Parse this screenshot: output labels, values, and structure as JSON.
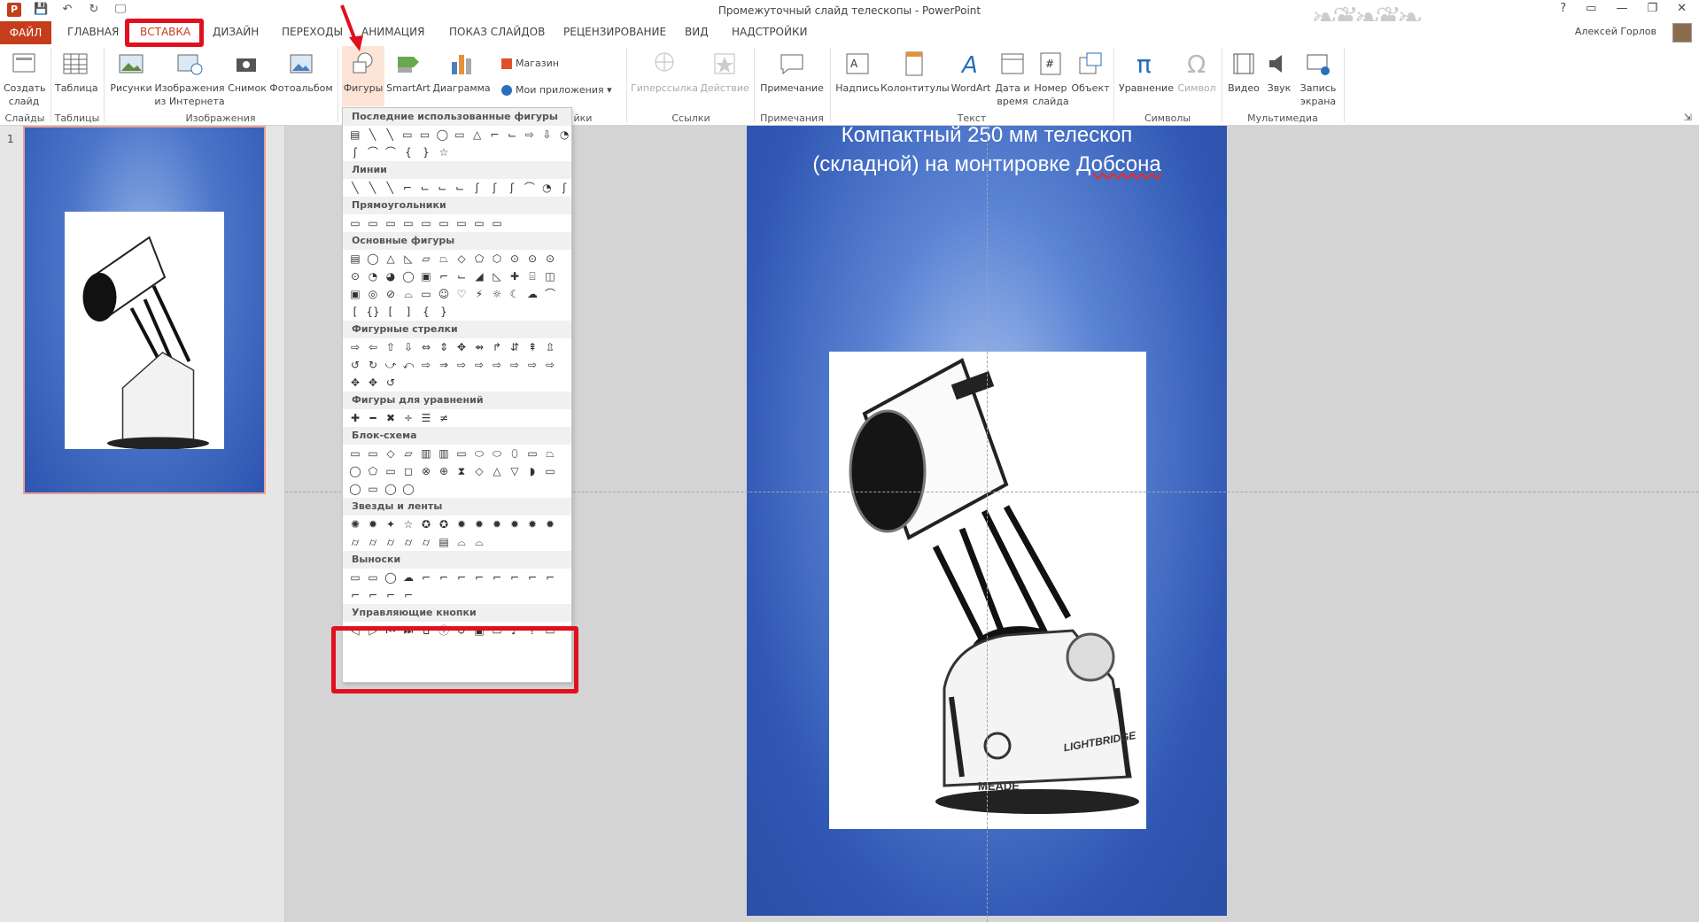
{
  "window": {
    "title": "Промежуточный слайд телескопы - PowerPoint",
    "controls": [
      "?",
      "▭",
      "—",
      "❐",
      "✕"
    ]
  },
  "qat": [
    "P",
    "💾",
    "↶",
    "↻",
    "🖵"
  ],
  "user": {
    "name": "Алексей Горлов"
  },
  "tabs": [
    {
      "label": "ФАЙЛ"
    },
    {
      "label": "ГЛАВНАЯ"
    },
    {
      "label": "ВСТАВКА"
    },
    {
      "label": "ДИЗАЙН"
    },
    {
      "label": "ПЕРЕХОДЫ"
    },
    {
      "label": "АНИМАЦИЯ"
    },
    {
      "label": "ПОКАЗ СЛАЙДОВ"
    },
    {
      "label": "РЕЦЕНЗИРОВАНИЕ"
    },
    {
      "label": "ВИД"
    },
    {
      "label": "НАДСТРОЙКИ"
    }
  ],
  "ribbon": {
    "new_slide": "Создать слайд",
    "table": "Таблица",
    "pictures": "Рисунки",
    "online_pictures": "Изображения из Интернета",
    "screenshot": "Снимок",
    "photo_album": "Фотоальбом",
    "shapes": "Фигуры",
    "smartart": "SmartArt",
    "chart": "Диаграмма",
    "store": "Магазин",
    "my_apps": "Мои приложения",
    "hyperlink": "Гиперссылка",
    "action": "Действие",
    "comment": "Примечание",
    "textbox": "Надпись",
    "header_footer": "Колонтитулы",
    "wordart": "WordArt",
    "date_time": "Дата и время",
    "slide_number": "Номер слайда",
    "object": "Объект",
    "equation": "Уравнение",
    "symbol": "Символ",
    "video": "Видео",
    "audio": "Звук",
    "screen_recording": "Запись экрана",
    "groups": {
      "slides": "Слайды",
      "tables": "Таблицы",
      "images": "Изображения",
      "addins_partial": "йки",
      "links": "Ссылки",
      "comments": "Примечания",
      "text": "Текст",
      "symbols": "Символы",
      "media": "Мультимедиа"
    }
  },
  "thumbnail": {
    "number": "1"
  },
  "shapes_menu": {
    "sections": [
      {
        "title": "Последние использованные фигуры",
        "rows": [
          [
            "▤",
            "╲",
            "╲",
            "▭",
            "▭",
            "◯",
            "▭",
            "△",
            "⌐",
            "⌙",
            "⇨",
            "⇩",
            "◔"
          ],
          [
            "ʃ",
            "⌒",
            "⌒",
            "{",
            "}",
            "☆"
          ]
        ]
      },
      {
        "title": "Линии",
        "rows": [
          [
            "╲",
            "╲",
            "╲",
            "⌐",
            "⌙",
            "⌙",
            "⌙",
            "ʃ",
            "ʃ",
            "ʃ",
            "⌒",
            "◔",
            "ʃ"
          ]
        ]
      },
      {
        "title": "Прямоугольники",
        "rows": [
          [
            "▭",
            "▭",
            "▭",
            "▭",
            "▭",
            "▭",
            "▭",
            "▭",
            "▭"
          ]
        ]
      },
      {
        "title": "Основные фигуры",
        "rows": [
          [
            "▤",
            "◯",
            "△",
            "◺",
            "▱",
            "⏢",
            "◇",
            "⬠",
            "⬡",
            "⊙",
            "⊙",
            "⊙"
          ],
          [
            "⊙",
            "◔",
            "◕",
            "◯",
            "▣",
            "⌐",
            "⌙",
            "◢",
            "◺",
            "✚",
            "⌸",
            "◫"
          ],
          [
            "▣",
            "◎",
            "⊘",
            "⌓",
            "▭",
            "☺",
            "♡",
            "⚡",
            "☼",
            "☾",
            "☁",
            "⌒"
          ],
          [
            "[",
            "{}",
            "[",
            "]",
            "{",
            "}"
          ]
        ]
      },
      {
        "title": "Фигурные стрелки",
        "rows": [
          [
            "⇨",
            "⇦",
            "⇧",
            "⇩",
            "⇔",
            "⇕",
            "✥",
            "⇴",
            "↱",
            "⇵",
            "⇞",
            "⇫"
          ],
          [
            "↺",
            "↻",
            "⤻",
            "⤺",
            "⇨",
            "⇒",
            "⇨",
            "⇨",
            "⇨",
            "⇨",
            "⇨",
            "⇨"
          ],
          [
            "✥",
            "✥",
            "↺"
          ]
        ]
      },
      {
        "title": "Фигуры для уравнений",
        "rows": [
          [
            "✚",
            "━",
            "✖",
            "÷",
            "☰",
            "≠"
          ]
        ]
      },
      {
        "title": "Блок-схема",
        "rows": [
          [
            "▭",
            "▭",
            "◇",
            "▱",
            "▥",
            "▥",
            "▭",
            "⬭",
            "⬭",
            "⬯",
            "▭",
            "⏢"
          ],
          [
            "◯",
            "⬠",
            "▭",
            "◻",
            "⊗",
            "⊕",
            "⧗",
            "◇",
            "△",
            "▽",
            "◗",
            "▭"
          ],
          [
            "◯",
            "▭",
            "◯",
            "◯"
          ]
        ]
      },
      {
        "title": "Звезды и ленты",
        "rows": [
          [
            "✺",
            "✹",
            "✦",
            "☆",
            "✪",
            "✪",
            "✹",
            "✹",
            "✹",
            "✹",
            "✹",
            "✹"
          ],
          [
            "⌭",
            "⌭",
            "⌭",
            "⌭",
            "⌭",
            "▤",
            "⌓",
            "⌓"
          ]
        ]
      },
      {
        "title": "Выноски",
        "rows": [
          [
            "▭",
            "▭",
            "◯",
            "☁",
            "⌐",
            "⌐",
            "⌐",
            "⌐",
            "⌐",
            "⌐",
            "⌐",
            "⌐"
          ],
          [
            "⌐",
            "⌐",
            "⌐",
            "⌐"
          ]
        ]
      },
      {
        "title": "Управляющие кнопки",
        "rows": [
          [
            "◁",
            "▷",
            "⏮",
            "⏭",
            "⌂",
            "ⓘ",
            "↺",
            "▣",
            "▭",
            "♪",
            "?",
            "▭"
          ]
        ]
      }
    ]
  },
  "slide": {
    "title_line1": "Компактный  250 мм телескоп",
    "title_line2_a": "(складной) на монтировке ",
    "title_line2_b": "Добсона",
    "brand": "MEADE",
    "model": "LIGHTBRIDGE"
  },
  "colors": {
    "accent": "#c43e1c",
    "highlight": "#e0101f",
    "slide_blue": "#2f57b3"
  }
}
